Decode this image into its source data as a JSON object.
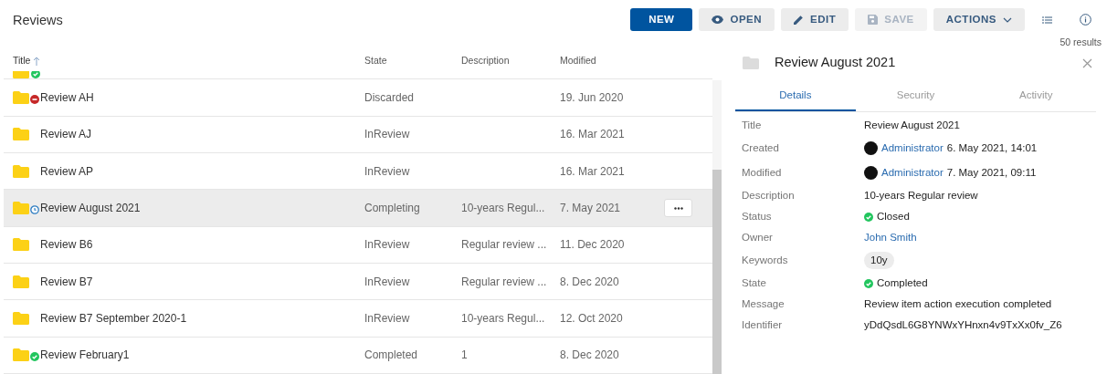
{
  "title": "Reviews",
  "toolbar": [
    {
      "label": "NEW",
      "kind": "primary",
      "disabled": false
    },
    {
      "label": "OPEN",
      "kind": "eye",
      "disabled": false
    },
    {
      "label": "EDIT",
      "kind": "pencil",
      "disabled": false
    },
    {
      "label": "SAVE",
      "kind": "save",
      "disabled": true
    },
    {
      "label": "ACTIONS",
      "kind": "menu",
      "disabled": false
    }
  ],
  "results": "50 results",
  "table": {
    "columns": [
      "Title",
      "State",
      "Description",
      "Modified"
    ],
    "partial_row": {
      "kind": "completed"
    },
    "rows": [
      {
        "title": "Review AH",
        "state": "Discarded",
        "description": "",
        "modified": "19. Jun 2020",
        "kind": "discarded",
        "selected": false
      },
      {
        "title": "Review AJ",
        "state": "InReview",
        "description": "",
        "modified": "16. Mar 2021",
        "kind": "none",
        "selected": false
      },
      {
        "title": "Review AP",
        "state": "InReview",
        "description": "",
        "modified": "16. Mar 2021",
        "kind": "none",
        "selected": false
      },
      {
        "title": "Review August 2021",
        "state": "Completing",
        "description": "10-years Regul...",
        "modified": "7. May 2021",
        "kind": "completing",
        "selected": true
      },
      {
        "title": "Review B6",
        "state": "InReview",
        "description": "Regular review ...",
        "modified": "11. Dec 2020",
        "kind": "none",
        "selected": false
      },
      {
        "title": "Review B7",
        "state": "InReview",
        "description": "Regular review ...",
        "modified": "8. Dec 2020",
        "kind": "none",
        "selected": false
      },
      {
        "title": "Review B7 September 2020-1",
        "state": "InReview",
        "description": "10-years Regul...",
        "modified": "12. Oct 2020",
        "kind": "none",
        "selected": false
      },
      {
        "title": "Review February1",
        "state": "Completed",
        "description": "1",
        "modified": "8. Dec 2020",
        "kind": "completed",
        "selected": false
      }
    ]
  },
  "panel": {
    "title": "Review August 2021",
    "tabs": [
      {
        "label": "Details",
        "selected": true
      },
      {
        "label": "Security",
        "selected": false
      },
      {
        "label": "Activity",
        "selected": false
      }
    ],
    "fields": [
      {
        "label": "Title",
        "kind": "text",
        "value": "Review August 2021"
      },
      {
        "label": "Created",
        "kind": "user",
        "user": "Administrator",
        "value": "6. May 2021, 14:01"
      },
      {
        "label": "Modified",
        "kind": "user",
        "user": "Administrator",
        "value": "7. May 2021, 09:11"
      },
      {
        "label": "Description",
        "kind": "text",
        "value": "10-years Regular review"
      },
      {
        "label": "Status",
        "kind": "status",
        "value": "Closed"
      },
      {
        "label": "Owner",
        "kind": "link",
        "value": "John Smith"
      },
      {
        "label": "Keywords",
        "kind": "chip",
        "value": "10y"
      },
      {
        "label": "State",
        "kind": "status",
        "value": "Completed"
      },
      {
        "label": "Message",
        "kind": "text",
        "value": "Review item action execution completed"
      },
      {
        "label": "Identifier",
        "kind": "text",
        "value": "yDdQsdL6G8YNWxYHnxn4v9TxXx0fv_Z6"
      }
    ]
  }
}
